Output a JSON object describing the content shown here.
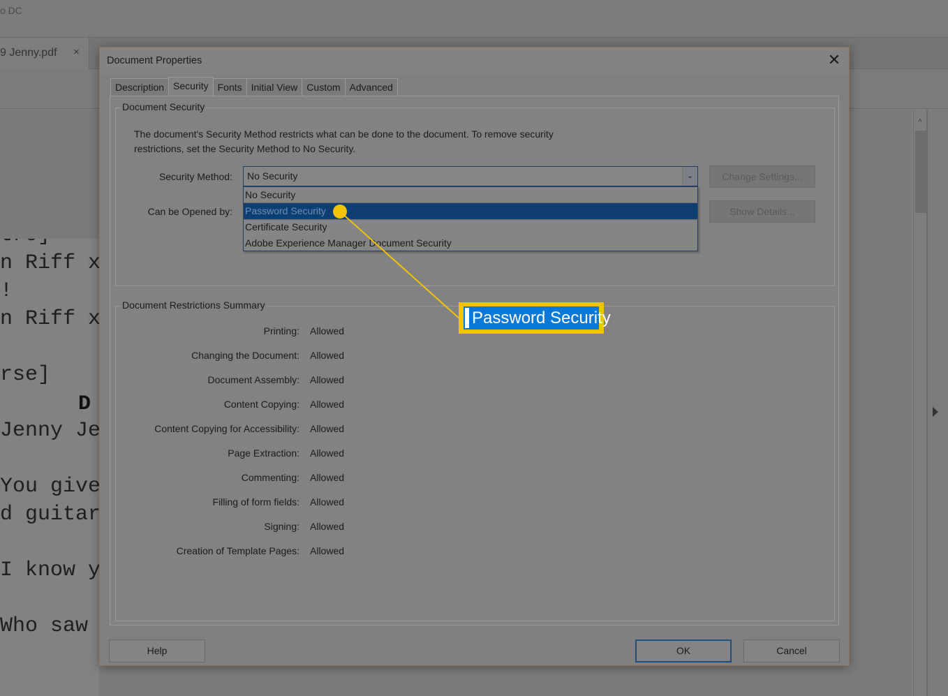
{
  "app": {
    "title_fragment": "o DC",
    "document_tab": "9 Jenny.pdf",
    "document_tab_close": "×"
  },
  "pdf_page": {
    "lines": [
      "tro]",
      "n Riff x",
      "!",
      "n Riff x",
      "",
      "rse]",
      "",
      "Jenny Je",
      "",
      "You give",
      "d guitar",
      "",
      "I know y",
      "",
      "Who saw"
    ],
    "chord": "D"
  },
  "scrollbar": {
    "up_arrow": "^"
  },
  "dialog": {
    "title": "Document Properties",
    "close": "✕",
    "tabs": [
      {
        "label": "Description",
        "active": false
      },
      {
        "label": "Security",
        "active": true
      },
      {
        "label": "Fonts",
        "active": false
      },
      {
        "label": "Initial View",
        "active": false
      },
      {
        "label": "Custom",
        "active": false
      },
      {
        "label": "Advanced",
        "active": false
      }
    ],
    "document_security": {
      "legend": "Document Security",
      "description": "The document's Security Method restricts what can be done to the document. To remove security restrictions, set the Security Method to No Security.",
      "security_method_label": "Security Method:",
      "security_method_value": "No Security",
      "dropdown_arrow": "⌄",
      "can_be_opened_label": "Can be Opened by:",
      "options": [
        {
          "label": "No Security",
          "highlighted": false
        },
        {
          "label": "Password Security",
          "highlighted": true
        },
        {
          "label": "Certificate Security",
          "highlighted": false
        },
        {
          "label": "Adobe Experience Manager Document Security",
          "highlighted": false
        }
      ],
      "change_settings_button": "Change Settings...",
      "show_details_button": "Show Details..."
    },
    "restrictions": {
      "legend": "Document Restrictions Summary",
      "rows": [
        {
          "label": "Printing:",
          "value": "Allowed"
        },
        {
          "label": "Changing the Document:",
          "value": "Allowed"
        },
        {
          "label": "Document Assembly:",
          "value": "Allowed"
        },
        {
          "label": "Content Copying:",
          "value": "Allowed"
        },
        {
          "label": "Content Copying for Accessibility:",
          "value": "Allowed"
        },
        {
          "label": "Page Extraction:",
          "value": "Allowed"
        },
        {
          "label": "Commenting:",
          "value": "Allowed"
        },
        {
          "label": "Filling of form fields:",
          "value": "Allowed"
        },
        {
          "label": "Signing:",
          "value": "Allowed"
        },
        {
          "label": "Creation of Template Pages:",
          "value": "Allowed"
        }
      ]
    },
    "buttons": {
      "help": "Help",
      "ok": "OK",
      "cancel": "Cancel"
    }
  },
  "callout": {
    "text": "Password Security",
    "color": "#f2c300",
    "highlight_color": "#0a78d7"
  }
}
